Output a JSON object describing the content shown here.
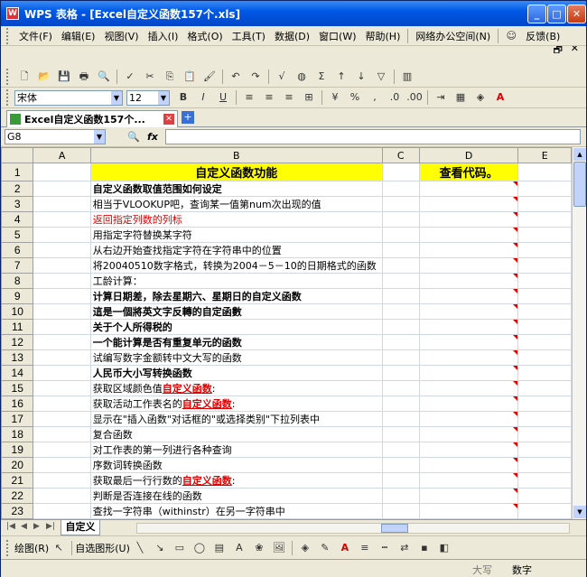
{
  "title": "WPS 表格 - [Excel自定义函数157个.xls]",
  "window_controls": {
    "min": "_",
    "max": "□",
    "close": "✕"
  },
  "menu": {
    "items": [
      "文件(F)",
      "编辑(E)",
      "视图(V)",
      "插入(I)",
      "格式(O)",
      "工具(T)",
      "数据(D)",
      "窗口(W)",
      "帮助(H)",
      "网络办公空间(N)"
    ],
    "feedback": "反馈(B)"
  },
  "font": {
    "name": "宋体",
    "size": "12"
  },
  "doc_tab": "Excel自定义函数157个...",
  "formula": {
    "cell_ref": "G8",
    "fx": "fx"
  },
  "columns": [
    "A",
    "B",
    "C",
    "D",
    "E"
  ],
  "rows": [
    {
      "n": "1",
      "b": "自定义函数功能",
      "d": "查看代码。"
    },
    {
      "n": "2",
      "b": "自定义函数取值范围如何设定"
    },
    {
      "n": "3",
      "b": "相当于VLOOKUP吧，查询某一值第num次出现的值"
    },
    {
      "n": "4",
      "b": "返回指定列数的列标"
    },
    {
      "n": "5",
      "b": "用指定字符替换某字符"
    },
    {
      "n": "6",
      "b": "从右边开始查找指定字符在字符串中的位置"
    },
    {
      "n": "7",
      "b": "将20040510数字格式，转换为2004－5－10的日期格式的函数"
    },
    {
      "n": "8",
      "b": "工龄计算："
    },
    {
      "n": "9",
      "b": "计算日期差，除去星期六、星期日的自定义函数"
    },
    {
      "n": "10",
      "b": "這是一個將英文字反轉的自定函數"
    },
    {
      "n": "11",
      "b": "关于个人所得税的"
    },
    {
      "n": "12",
      "b": "一个能计算是否有重复单元的函数"
    },
    {
      "n": "13",
      "b": "试编写数字金额转中文大写的函数"
    },
    {
      "n": "14",
      "b": "人民币大小写转换函数"
    },
    {
      "n": "15",
      "b": "获取区域颜色值",
      "link": "自定义函数",
      "tail": ":"
    },
    {
      "n": "16",
      "b": "获取活动工作表名的",
      "link": "自定义函数",
      "tail": ":"
    },
    {
      "n": "17",
      "b": "显示在\"插入函数\"对话框的\"或选择类别\"下拉列表中"
    },
    {
      "n": "18",
      "b": "复合函数"
    },
    {
      "n": "19",
      "b": "对工作表的第一列进行各种查询"
    },
    {
      "n": "20",
      "b": "序数词转换函数"
    },
    {
      "n": "21",
      "b": "获取最后一行行数的",
      "link": "自定义函数",
      "tail": ":"
    },
    {
      "n": "22",
      "b": "判断是否连接在线的函数"
    },
    {
      "n": "23",
      "b": "查找一字符串（withinstr）在另一字符串中"
    }
  ],
  "sheet_tab": "自定义",
  "drawbar": {
    "draw": "绘图(R)",
    "autoshape": "自选图形(U)"
  },
  "status": {
    "caps": "大写",
    "num": "数字"
  },
  "colors": {
    "header_yellow": "#ffff00",
    "red_text": "#e00000",
    "titlebar": "#0058e6"
  }
}
